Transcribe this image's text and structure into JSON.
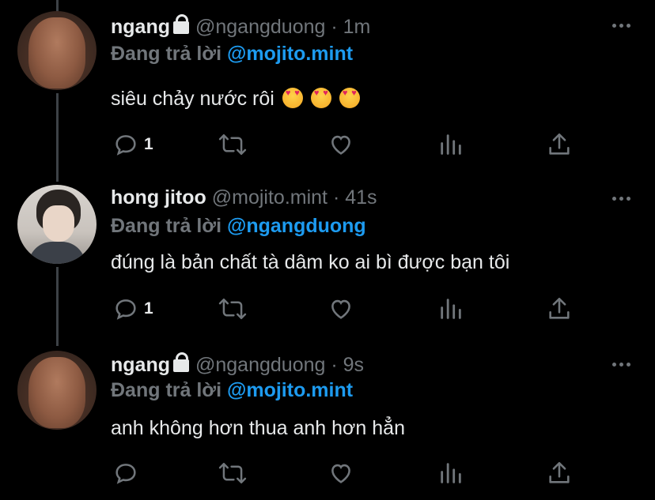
{
  "tweets": [
    {
      "name": "ngang",
      "handle": "@ngangduong",
      "time": "1m",
      "locked": true,
      "avatar_icon": "avatar-rock",
      "reply_label": "Đang trả lời",
      "reply_to": "@mojito.mint",
      "text": "siêu chảy nước rôi",
      "emoji": [
        "heart-eyes-emoji",
        "heart-eyes-emoji",
        "heart-eyes-emoji"
      ],
      "reply_count": "1"
    },
    {
      "name": "hong jitoo",
      "handle": "@mojito.mint",
      "time": "41s",
      "locked": false,
      "avatar_icon": "avatar-boy",
      "reply_label": "Đang trả lời",
      "reply_to": "@ngangduong",
      "text": "đúng là bản chất tà dâm ko ai bì được bạn tôi",
      "emoji": [],
      "reply_count": "1"
    },
    {
      "name": "ngang",
      "handle": "@ngangduong",
      "time": "9s",
      "locked": true,
      "avatar_icon": "avatar-rock",
      "reply_label": "Đang trả lời",
      "reply_to": "@mojito.mint",
      "text": "anh không hơn thua anh hơn hẳn",
      "emoji": [],
      "reply_count": ""
    }
  ],
  "separator": "·",
  "icons": [
    "reply-icon",
    "retweet-icon",
    "like-icon",
    "analytics-icon",
    "share-icon",
    "more-icon",
    "lock-icon"
  ],
  "colors": {
    "background": "#000000",
    "text": "#e7e9ea",
    "muted": "#71767b",
    "accent": "#1d9bf0"
  }
}
